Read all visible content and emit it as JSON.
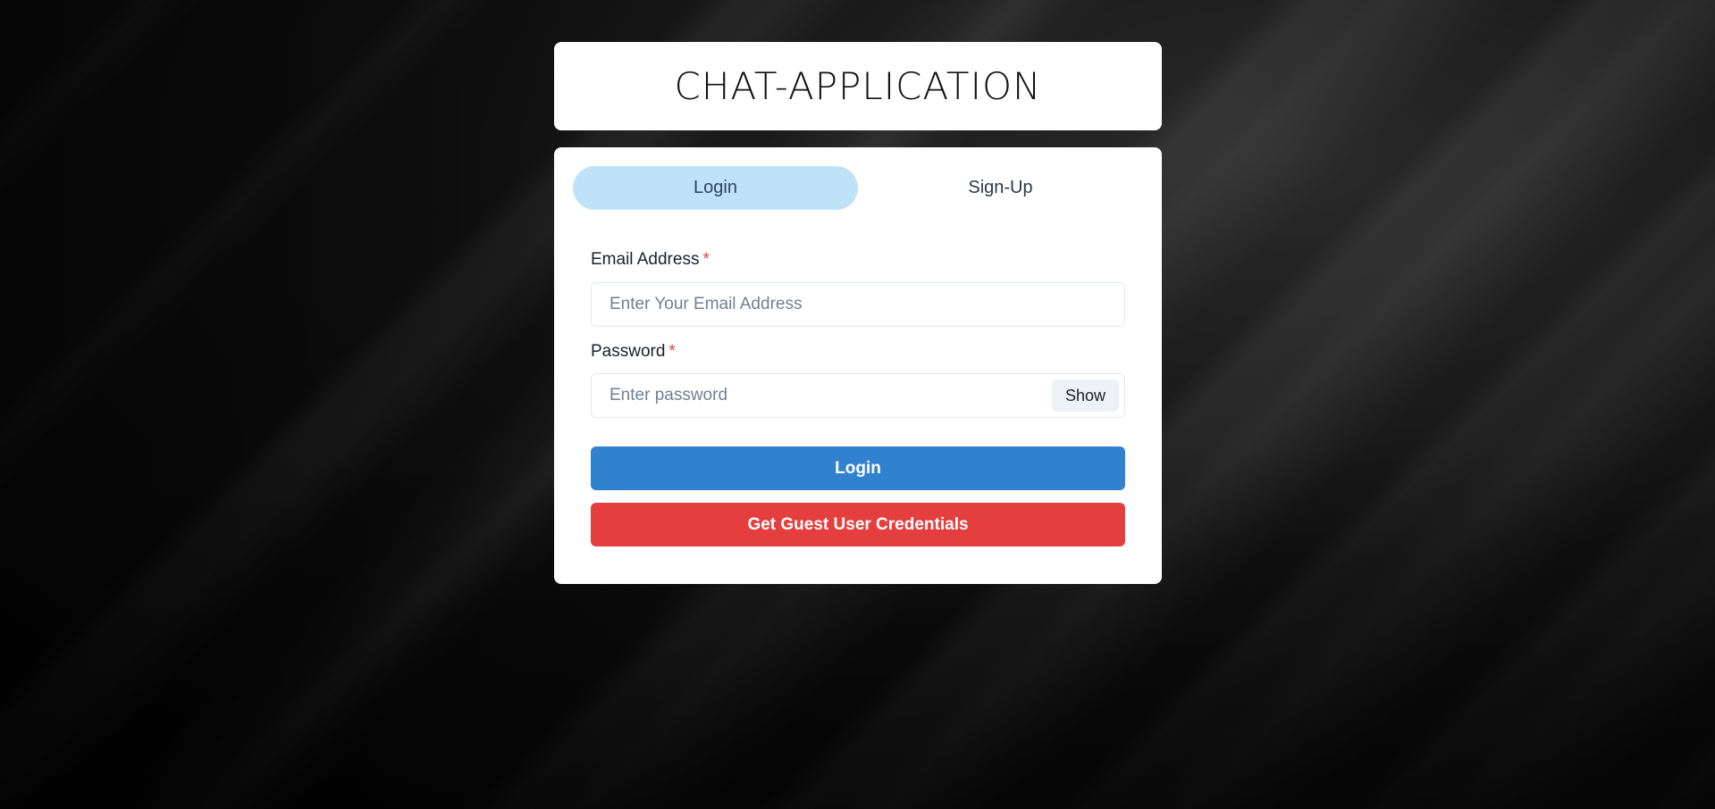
{
  "app": {
    "title": "CHAT-APPLICATION"
  },
  "tabs": [
    {
      "label": "Login",
      "active": true
    },
    {
      "label": "Sign-Up",
      "active": false
    }
  ],
  "form": {
    "email": {
      "label": "Email Address",
      "required_mark": "*",
      "value": "",
      "placeholder": "Enter Your Email Address"
    },
    "password": {
      "label": "Password",
      "required_mark": "*",
      "value": "",
      "placeholder": "Enter password",
      "toggle_label": "Show"
    },
    "login_button": "Login",
    "guest_button": "Get Guest User Credentials"
  },
  "colors": {
    "active_tab": "#bee3f8",
    "login_button": "#3182ce",
    "guest_button": "#e53e3e",
    "required": "#e53e3e"
  }
}
